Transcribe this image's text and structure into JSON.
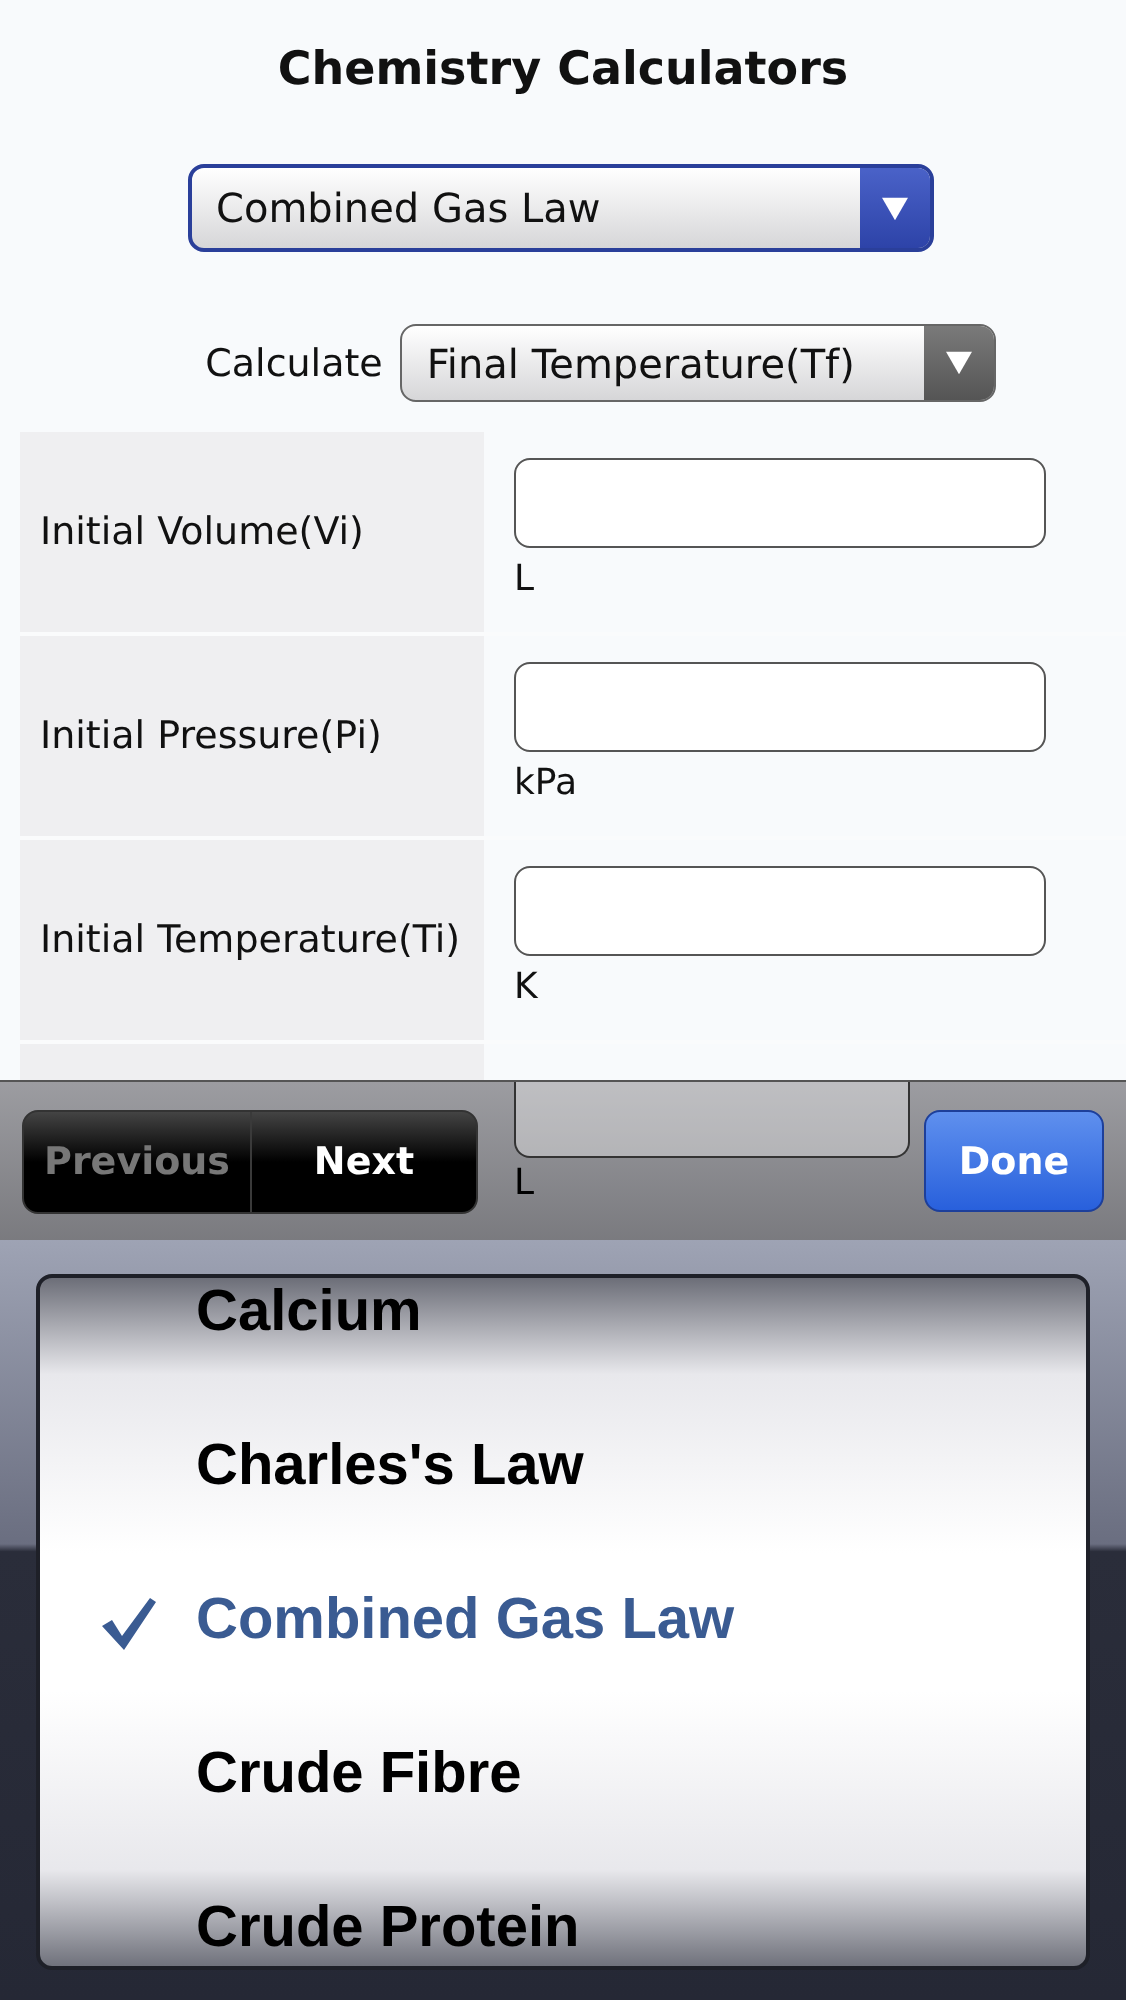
{
  "title": "Chemistry Calculators",
  "calculator_select": {
    "value": "Combined Gas Law"
  },
  "calculate": {
    "label": "Calculate",
    "value": "Final Temperature(Tf)"
  },
  "fields": [
    {
      "label": "Initial Volume(Vi)",
      "unit": "L"
    },
    {
      "label": "Initial Pressure(Pi)",
      "unit": "kPa"
    },
    {
      "label": "Initial Temperature(Ti)",
      "unit": "K"
    },
    {
      "unit": "L"
    }
  ],
  "toolbar": {
    "previous": {
      "label": "Previous",
      "disabled": true
    },
    "next": {
      "label": "Next",
      "disabled": false
    },
    "done": "Done"
  },
  "picker": [
    {
      "label": "Calcium",
      "selected": false
    },
    {
      "label": "Charles's Law",
      "selected": false
    },
    {
      "label": "Combined Gas Law",
      "selected": true
    },
    {
      "label": "Crude Fibre",
      "selected": false
    },
    {
      "label": "Crude Protein",
      "selected": false
    }
  ]
}
